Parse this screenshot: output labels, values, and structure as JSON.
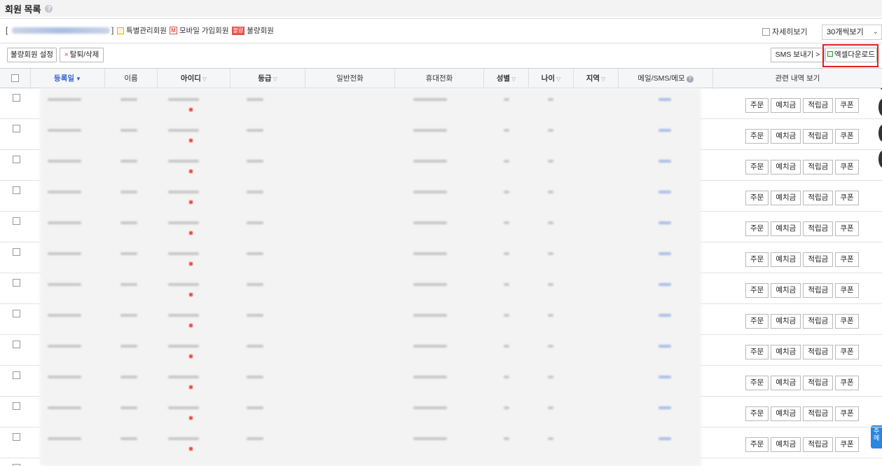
{
  "page": {
    "title": "회원 목록"
  },
  "legend": {
    "special": "특별관리회원",
    "mobile_icon": "M",
    "mobile": "모바일 가입회원",
    "bad_icon": "불량",
    "bad": "불량회원"
  },
  "options": {
    "detail_view": "자세히보기",
    "per_page": "30개씩보기"
  },
  "toolbar": {
    "bad_member_setting": "불량회원 설정",
    "withdraw_delete_icon": "×",
    "withdraw_delete": "탈퇴/삭제",
    "sms_send": "SMS 보내기 >",
    "excel_download": "엑셀다운로드"
  },
  "table": {
    "columns": [
      {
        "key": "reg_date",
        "label": "등록일",
        "sort": "▼"
      },
      {
        "key": "name",
        "label": "이름"
      },
      {
        "key": "id",
        "label": "아이디",
        "sort": "▽"
      },
      {
        "key": "grade",
        "label": "등급",
        "sort": "▽"
      },
      {
        "key": "phone",
        "label": "일반전화"
      },
      {
        "key": "mobile",
        "label": "휴대전화"
      },
      {
        "key": "gender",
        "label": "성별",
        "sort": "▽"
      },
      {
        "key": "age",
        "label": "나이",
        "sort": "▽"
      },
      {
        "key": "region",
        "label": "지역",
        "sort": "▽"
      },
      {
        "key": "contact",
        "label": "메일/SMS/메모"
      },
      {
        "key": "history",
        "label": "관련 내역 보기"
      }
    ],
    "row_actions": [
      "주문",
      "예치금",
      "적립금",
      "쿠폰"
    ]
  },
  "side_float": {
    "label": "주메"
  },
  "colors": {
    "accent_blue": "#2f62d3",
    "highlight_red": "#e02020",
    "bad_badge": "#e8524a"
  }
}
